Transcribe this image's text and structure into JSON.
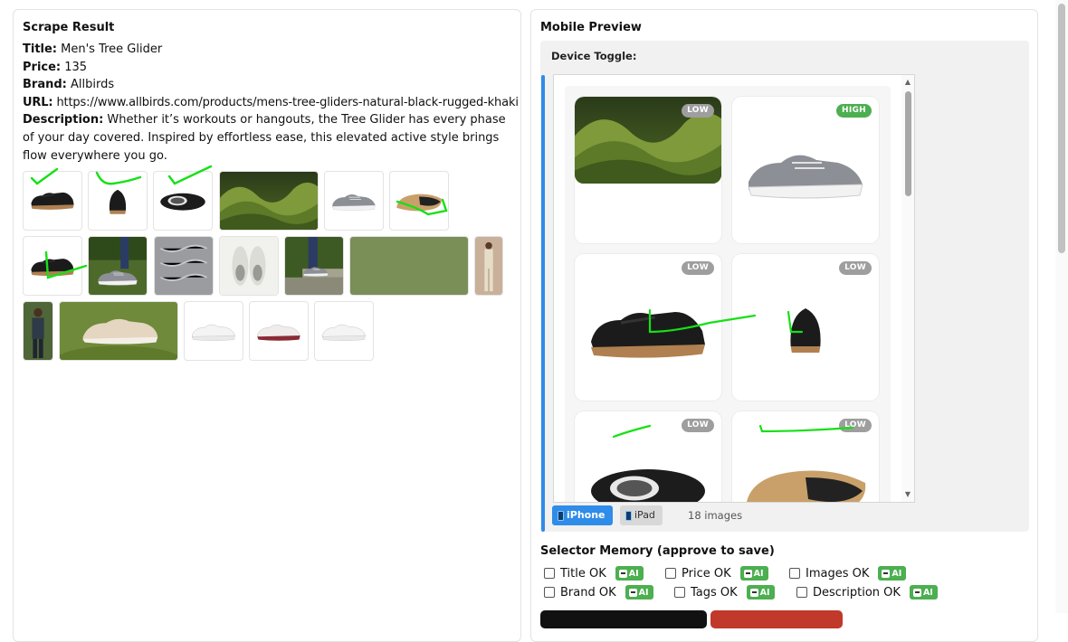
{
  "scrape": {
    "heading": "Scrape Result",
    "title_label": "Title:",
    "title_value": "Men's Tree Glider",
    "price_label": "Price:",
    "price_value": "135",
    "brand_label": "Brand:",
    "brand_value": "Allbirds",
    "url_label": "URL:",
    "url_value": "https://www.allbirds.com/products/mens-tree-gliders-natural-black-rugged-khaki",
    "description_label": "Description:",
    "description_value": "Whether it’s workouts or hangouts, the Tree Glider has every phase of your day covered. Inspired by effortless ease, this elevated active style brings flow everywhere you go.",
    "thumbnails": [
      "black-shoe-side",
      "black-shoe-back",
      "black-shoe-top",
      "green-hills",
      "grey-shoe-side",
      "shoe-sole",
      "black-shoe-angle",
      "grey-shoe-lifestyle",
      "knit-texture",
      "shoe-pair-top",
      "stairs-lifestyle",
      "olive-swatch",
      "model-standing",
      "model-portrait",
      "beige-shoe-display",
      "white-shoe-side",
      "white-red-shoe",
      "white-shoe-angle"
    ]
  },
  "preview": {
    "heading": "Mobile Preview",
    "device_toggle_label": "Device Toggle:",
    "cards": [
      {
        "subject": "green-hills",
        "badge": "LOW"
      },
      {
        "subject": "grey-shoe",
        "badge": "HIGH"
      },
      {
        "subject": "black-shoe-side",
        "badge": "LOW"
      },
      {
        "subject": "black-shoe-back",
        "badge": "LOW"
      },
      {
        "subject": "black-shoe-top",
        "badge": "LOW"
      },
      {
        "subject": "shoe-sole",
        "badge": "LOW"
      }
    ],
    "iphone_label": "iPhone",
    "ipad_label": "iPad",
    "image_count": "18 images",
    "active_device": "iPhone"
  },
  "memory": {
    "heading": "Selector Memory (approve to save)",
    "checks": [
      {
        "label": "Title OK",
        "checked": false,
        "badge": "AI"
      },
      {
        "label": "Price OK",
        "checked": false,
        "badge": "AI"
      },
      {
        "label": "Images OK",
        "checked": false,
        "badge": "AI"
      },
      {
        "label": "Brand OK",
        "checked": false,
        "badge": "AI"
      },
      {
        "label": "Tags OK",
        "checked": false,
        "badge": "AI"
      },
      {
        "label": "Description OK",
        "checked": false,
        "badge": "AI"
      }
    ]
  },
  "colors": {
    "accent": "#2f8ce8",
    "badge_low": "#9e9e9e",
    "badge_high": "#4caf50",
    "ai_badge": "#4caf50",
    "annotation": "#16e016"
  }
}
